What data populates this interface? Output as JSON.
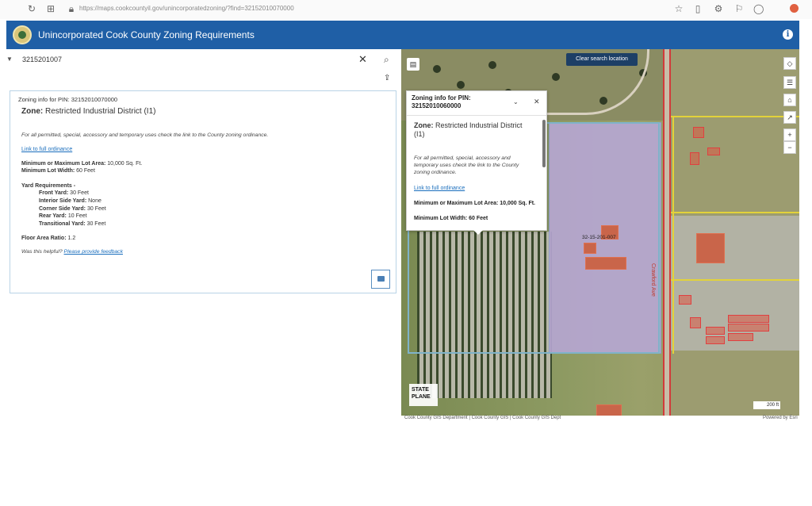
{
  "browser": {
    "url": "https://maps.cookcountyil.gov/unincorporatedzoning/?find=32152010070000"
  },
  "header": {
    "title": "Unincorporated Cook County Zoning Requirements"
  },
  "search": {
    "value": "3215201007"
  },
  "zoning_card": {
    "pin_label": "Zoning info for PIN: 32152010070000",
    "zone_label": "Zone:",
    "zone_value": "Restricted Industrial District (I1)",
    "note": "For all permitted, special, accessory and temporary uses check the link to the County zoning ordinance.",
    "link": "Link to full ordinance",
    "min_lot_area_label": "Minimum or Maximum Lot Area:",
    "min_lot_area_value": "10,000 Sq. Ft.",
    "min_lot_width_label": "Minimum Lot Width:",
    "min_lot_width_value": "60 Feet",
    "yard_heading": "Yard Requirements -",
    "yards": [
      {
        "label": "Front Yard:",
        "value": "30 Feet"
      },
      {
        "label": "Interior Side Yard:",
        "value": "None"
      },
      {
        "label": "Corner Side Yard:",
        "value": "30 Feet"
      },
      {
        "label": "Rear Yard:",
        "value": "10 Feet"
      },
      {
        "label": "Transitional Yard:",
        "value": "30 Feet"
      }
    ],
    "far_label": "Floor Area Ratio:",
    "far_value": "1.2",
    "helpful": "Was this helpful?",
    "feedback_link": "Please provide feedback"
  },
  "map": {
    "clear_search": "Clear search location",
    "parcel_label": "32-15-201-007",
    "road_label": "Crawford Ave",
    "state_plane": "STATE PLANE",
    "scale": "200 ft",
    "attribution": "Cook County GIS Department | Cook County GIS | Cook County GIS Dept",
    "powered_by": "Powered by Esri"
  },
  "popup": {
    "title_line1": "Zoning info for PIN:",
    "title_line2": "32152010060000",
    "zone_label": "Zone:",
    "zone_value": "Restricted Industrial District (I1)",
    "note": "For all permitted, special, accessory and temporary uses check the link to the County zoning ordinance.",
    "link": "Link to full ordinance",
    "min_lot_area": "Minimum or Maximum Lot Area: 10,000 Sq. Ft.",
    "min_lot_width": "Minimum Lot Width: 60 Feet"
  }
}
